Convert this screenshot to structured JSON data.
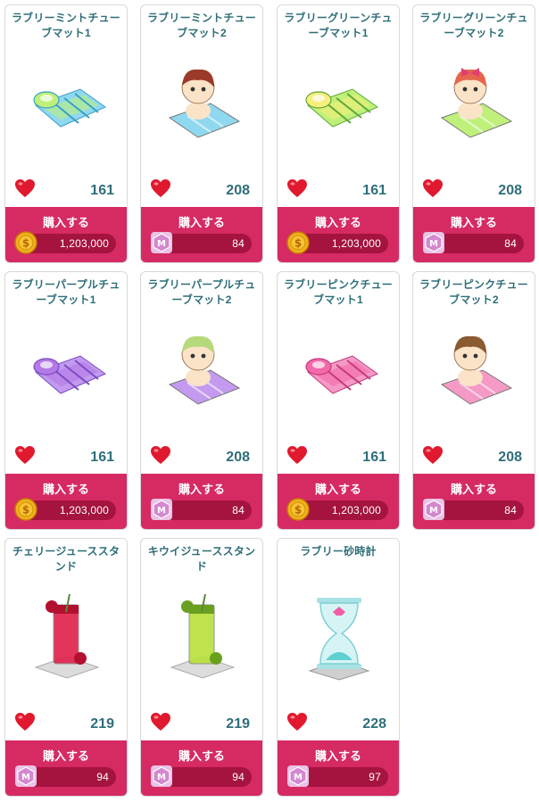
{
  "buy_label": "購入する",
  "colors": {
    "accent": "#d62a63",
    "price_bar": "#a5133f",
    "title": "#2e6e78"
  },
  "items": [
    {
      "title": "ラブリーミントチューブマット1",
      "likes": "161",
      "currency": "meso-coin-icon",
      "price": "1,203,000",
      "art": "mat-mint"
    },
    {
      "title": "ラブリーミントチューブマット2",
      "likes": "208",
      "currency": "maple-point-gem-icon",
      "price": "84",
      "art": "mat-mint-boy"
    },
    {
      "title": "ラブリーグリーンチューブマット1",
      "likes": "161",
      "currency": "meso-coin-icon",
      "price": "1,203,000",
      "art": "mat-green"
    },
    {
      "title": "ラブリーグリーンチューブマット2",
      "likes": "208",
      "currency": "maple-point-gem-icon",
      "price": "84",
      "art": "mat-green-girl"
    },
    {
      "title": "ラブリーパープルチューブマット1",
      "likes": "161",
      "currency": "meso-coin-icon",
      "price": "1,203,000",
      "art": "mat-purple"
    },
    {
      "title": "ラブリーパープルチューブマット2",
      "likes": "208",
      "currency": "maple-point-gem-icon",
      "price": "84",
      "art": "mat-purple-boy"
    },
    {
      "title": "ラブリーピンクチューブマット1",
      "likes": "161",
      "currency": "meso-coin-icon",
      "price": "1,203,000",
      "art": "mat-pink"
    },
    {
      "title": "ラブリーピンクチューブマット2",
      "likes": "208",
      "currency": "maple-point-gem-icon",
      "price": "84",
      "art": "mat-pink-girl"
    },
    {
      "title": "チェリージューススタンド",
      "likes": "219",
      "currency": "maple-point-gem-icon",
      "price": "94",
      "art": "cherry-juice"
    },
    {
      "title": "キウイジューススタンド",
      "likes": "219",
      "currency": "maple-point-gem-icon",
      "price": "94",
      "art": "kiwi-juice"
    },
    {
      "title": "ラブリー砂時計",
      "likes": "228",
      "currency": "maple-point-gem-icon",
      "price": "97",
      "art": "hourglass"
    }
  ]
}
